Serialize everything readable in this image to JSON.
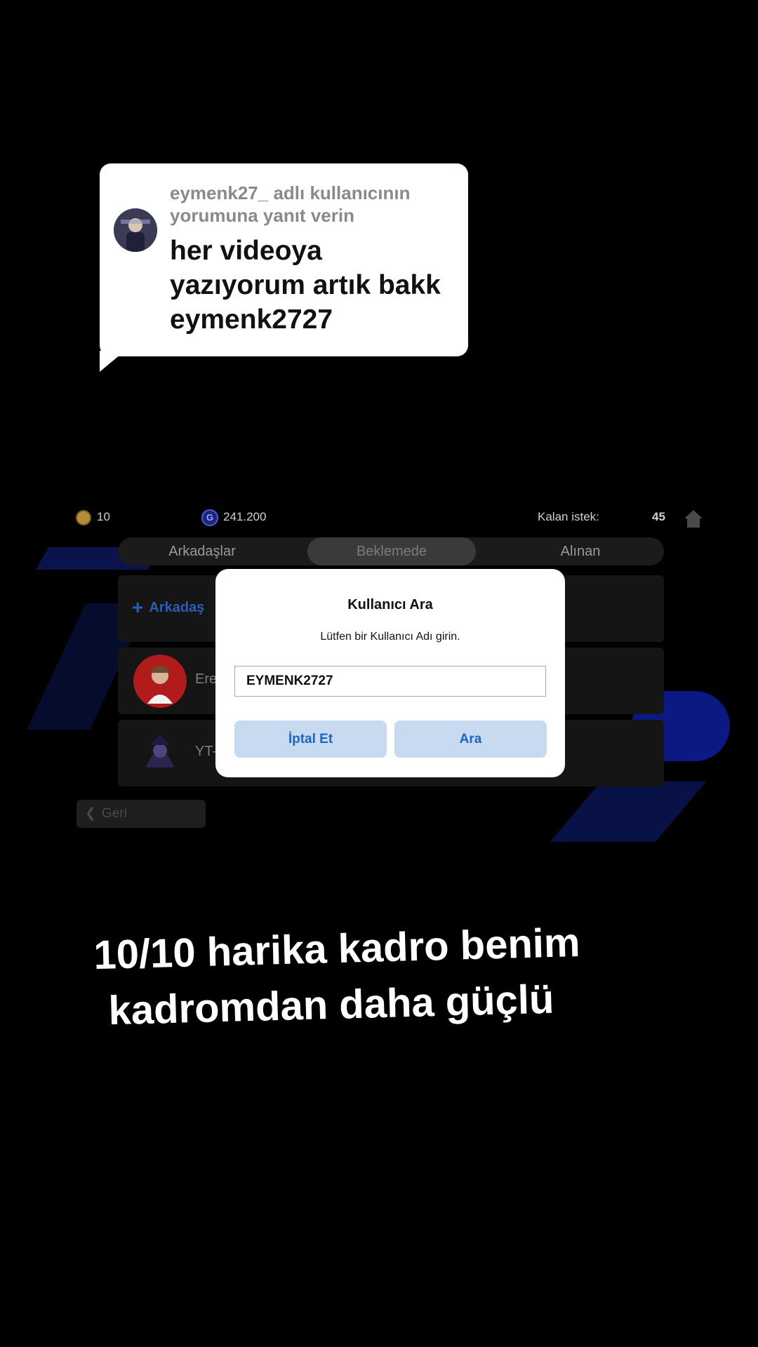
{
  "reply": {
    "header": "eymenk27_ adlı kullanıcının yorumuna yanıt verin",
    "text_lines": [
      "her videoya",
      "yazıyorum artık bakk",
      "eymenk2727"
    ]
  },
  "top_bar": {
    "coin_value": "10",
    "gp_icon_letter": "G",
    "gp_value": "241.200",
    "requests_label": "Kalan istek:",
    "requests_value": "45",
    "icons": [
      "coin-icon",
      "gp-icon",
      "home-icon"
    ]
  },
  "tabs": [
    {
      "label": "Arkadaşlar"
    },
    {
      "label": "Beklemede",
      "active": true
    },
    {
      "label": "Alınan"
    }
  ],
  "list": {
    "add_friend_label": "Arkadaş",
    "players": [
      {
        "name": "Ere"
      },
      {
        "name": "YT-"
      }
    ]
  },
  "back_label": "Geri",
  "modal": {
    "title": "Kullanıcı Ara",
    "subtitle": "Lütfen bir Kullanıcı Adı girin.",
    "input_value": "EYMENK2727",
    "cancel_label": "İptal Et",
    "search_label": "Ara"
  },
  "caption": {
    "line1": "10/10 harika kadro benim",
    "line2": "kadromdan daha güçlü"
  },
  "colors": {
    "background": "#000000",
    "accent_blue": "#1f66c4",
    "button_bg": "#c8daf0",
    "deco_blue": "#0b1554"
  }
}
